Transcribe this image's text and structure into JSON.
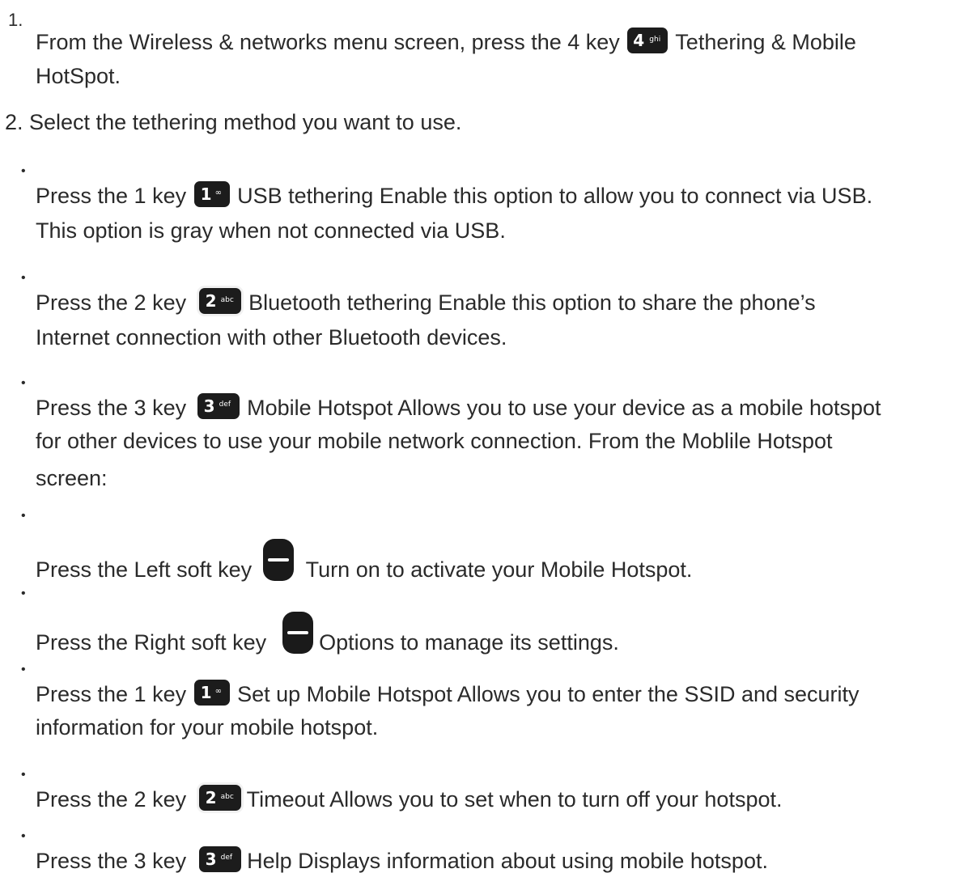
{
  "steps": [
    {
      "marker": "1.",
      "lines": [
        {
          "before": "From the Wireless & networks menu screen, press the 4 key",
          "key": {
            "digit": "4",
            "letters": "ghi",
            "kind": "number"
          },
          "after": "Tethering & Mobile"
        },
        {
          "text": "HotSpot."
        }
      ]
    },
    {
      "marker": "",
      "lines": [
        {
          "text": "2. Select the tethering method you want to use."
        }
      ]
    },
    {
      "marker": "•",
      "lines": [
        {
          "before": "Press the 1 key",
          "key": {
            "digit": "1",
            "letters": "∞",
            "kind": "number"
          },
          "after": "USB tethering Enable this option to allow you to connect via USB."
        },
        {
          "text": "This option is gray when not connected via USB."
        }
      ]
    },
    {
      "marker": "•",
      "lines": [
        {
          "before": "Press the 2 key",
          "key": {
            "digit": "2",
            "letters": "abc",
            "kind": "number"
          },
          "after": "Bluetooth tethering Enable this option to share the phone’s"
        },
        {
          "text": "Internet connection with other Bluetooth devices."
        }
      ]
    },
    {
      "marker": "•",
      "lines": [
        {
          "before": "Press the 3 key",
          "key": {
            "digit": "3",
            "letters": "def",
            "kind": "number"
          },
          "after": "Mobile Hotspot Allows you to use your device as a mobile hotspot"
        },
        {
          "text": "for other devices to use your mobile network connection. From the Moblile Hotspot"
        },
        {
          "text": "screen:"
        }
      ]
    },
    {
      "marker": "•",
      "lines": [
        {
          "before": "Press the Left soft key",
          "key": {
            "kind": "soft"
          },
          "after": "Turn on to activate your Mobile Hotspot."
        }
      ]
    },
    {
      "marker": "•",
      "lines": [
        {
          "before": "Press the Right soft key",
          "key": {
            "kind": "soft"
          },
          "after": "Options to manage its settings."
        }
      ]
    },
    {
      "marker": "•",
      "lines": [
        {
          "before": "Press the 1 key",
          "key": {
            "digit": "1",
            "letters": "∞",
            "kind": "number"
          },
          "after": "Set up Mobile Hotspot Allows you to enter the SSID and security"
        },
        {
          "text": "information for your mobile hotspot."
        }
      ]
    },
    {
      "marker": "•",
      "lines": [
        {
          "before": "Press the 2 key",
          "key": {
            "digit": "2",
            "letters": "abc",
            "kind": "number"
          },
          "after": "Timeout Allows you to set when to turn off your hotspot."
        }
      ]
    },
    {
      "marker": "•",
      "lines": [
        {
          "before": "Press the 3 key",
          "key": {
            "digit": "3",
            "letters": "def",
            "kind": "number"
          },
          "after": "Help Displays information about using mobile hotspot."
        }
      ]
    }
  ]
}
